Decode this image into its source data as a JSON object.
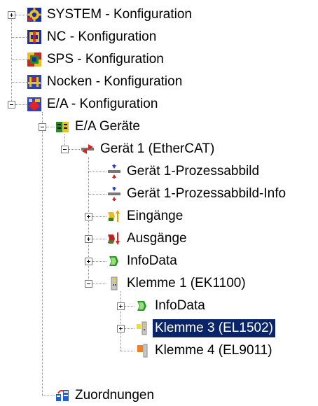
{
  "tree": {
    "system": "SYSTEM - Konfiguration",
    "nc": "NC - Konfiguration",
    "sps": "SPS - Konfiguration",
    "nocken": "Nocken - Konfiguration",
    "ea": "E/A - Konfiguration",
    "ea_geraete": "E/A Geräte",
    "geraet1": "Gerät 1 (EtherCAT)",
    "prozessabbild": "Gerät 1-Prozessabbild",
    "prozessabbild_info": "Gerät 1-Prozessabbild-Info",
    "eingaenge": "Eingänge",
    "ausgaenge": "Ausgänge",
    "infodata": "InfoData",
    "klemme1": "Klemme 1 (EK1100)",
    "klemme1_infodata": "InfoData",
    "klemme3": "Klemme 3 (EL1502)",
    "klemme4": "Klemme 4 (EL9011)",
    "zuordnungen": "Zuordnungen"
  },
  "colors": {
    "selection": "#0a246a",
    "tree_lines": "#8c8c8c"
  },
  "icons": {
    "system": "system-gear-icon",
    "nc": "nc-axis-icon",
    "sps": "plc-icon",
    "nocken": "cam-icon",
    "ea": "io-config-icon",
    "ea_geraete": "io-devices-icon",
    "geraet1": "ethercat-device-icon",
    "prozessabbild": "process-image-icon",
    "eingaenge": "inputs-icon",
    "ausgaenge": "outputs-icon",
    "infodata": "infodata-icon",
    "klemme": "terminal-icon",
    "zuordnungen": "mappings-icon"
  }
}
